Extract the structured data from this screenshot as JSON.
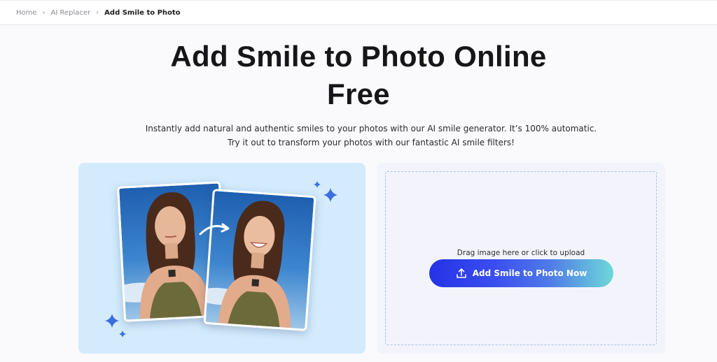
{
  "breadcrumb": {
    "items": [
      "Home",
      "AI Replacer",
      "Add Smile to Photo"
    ]
  },
  "hero": {
    "title_line1": "Add Smile to Photo Online",
    "title_line2": "Free",
    "subtitle": "Instantly add natural and authentic smiles to your photos with our AI smile generator. It’s 100% automatic. Try it out to transform your photos with our fantastic AI smile filters!"
  },
  "upload": {
    "drag_hint": "Drag image here or click to upload",
    "button_label": "Add Smile to Photo Now"
  },
  "icons": {
    "breadcrumb_separator": "chevron-right-icon",
    "upload": "upload-icon",
    "sparkle": "sparkle-icon",
    "arrow": "curved-arrow-icon"
  },
  "colors": {
    "preview_bg": "#d3ebfd",
    "upload_bg": "#f3f4fb",
    "cta_gradient_start": "#2433e6",
    "cta_gradient_end": "#6ed8d8",
    "sparkle": "#3b6fe0"
  }
}
